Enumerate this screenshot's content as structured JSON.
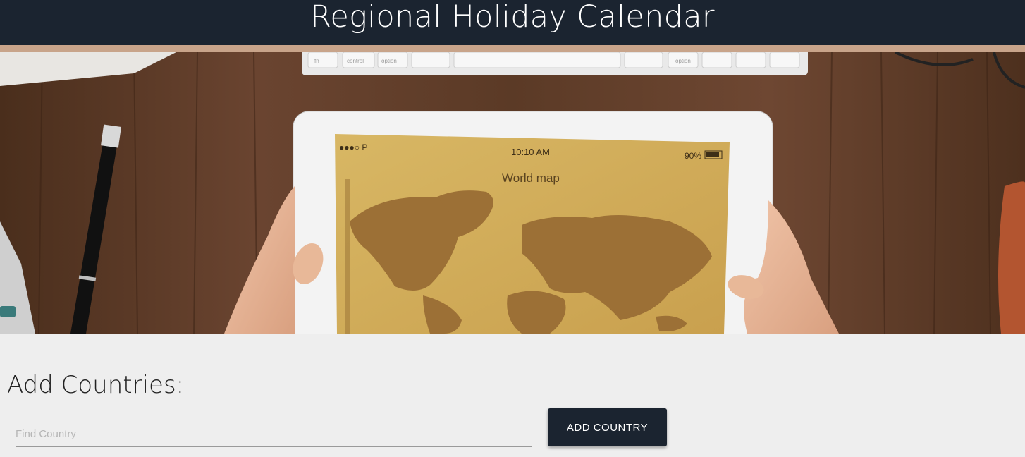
{
  "header": {
    "title": "Regional Holiday Calendar"
  },
  "hero": {
    "tablet": {
      "carrier": "●●●○ P",
      "time": "10:10 AM",
      "battery": "90%",
      "app_title": "World map"
    },
    "keyboard_keys": [
      "fn",
      "control",
      "option",
      "option"
    ]
  },
  "add_section": {
    "title": "Add Countries:",
    "search_placeholder": "Find Country",
    "search_value": "",
    "button_label": "ADD COUNTRY"
  },
  "colors": {
    "header_bg": "#1b2430",
    "accent_bar": "#c8a48a",
    "button_bg": "#1b2430",
    "page_bg": "#eeeeee"
  }
}
